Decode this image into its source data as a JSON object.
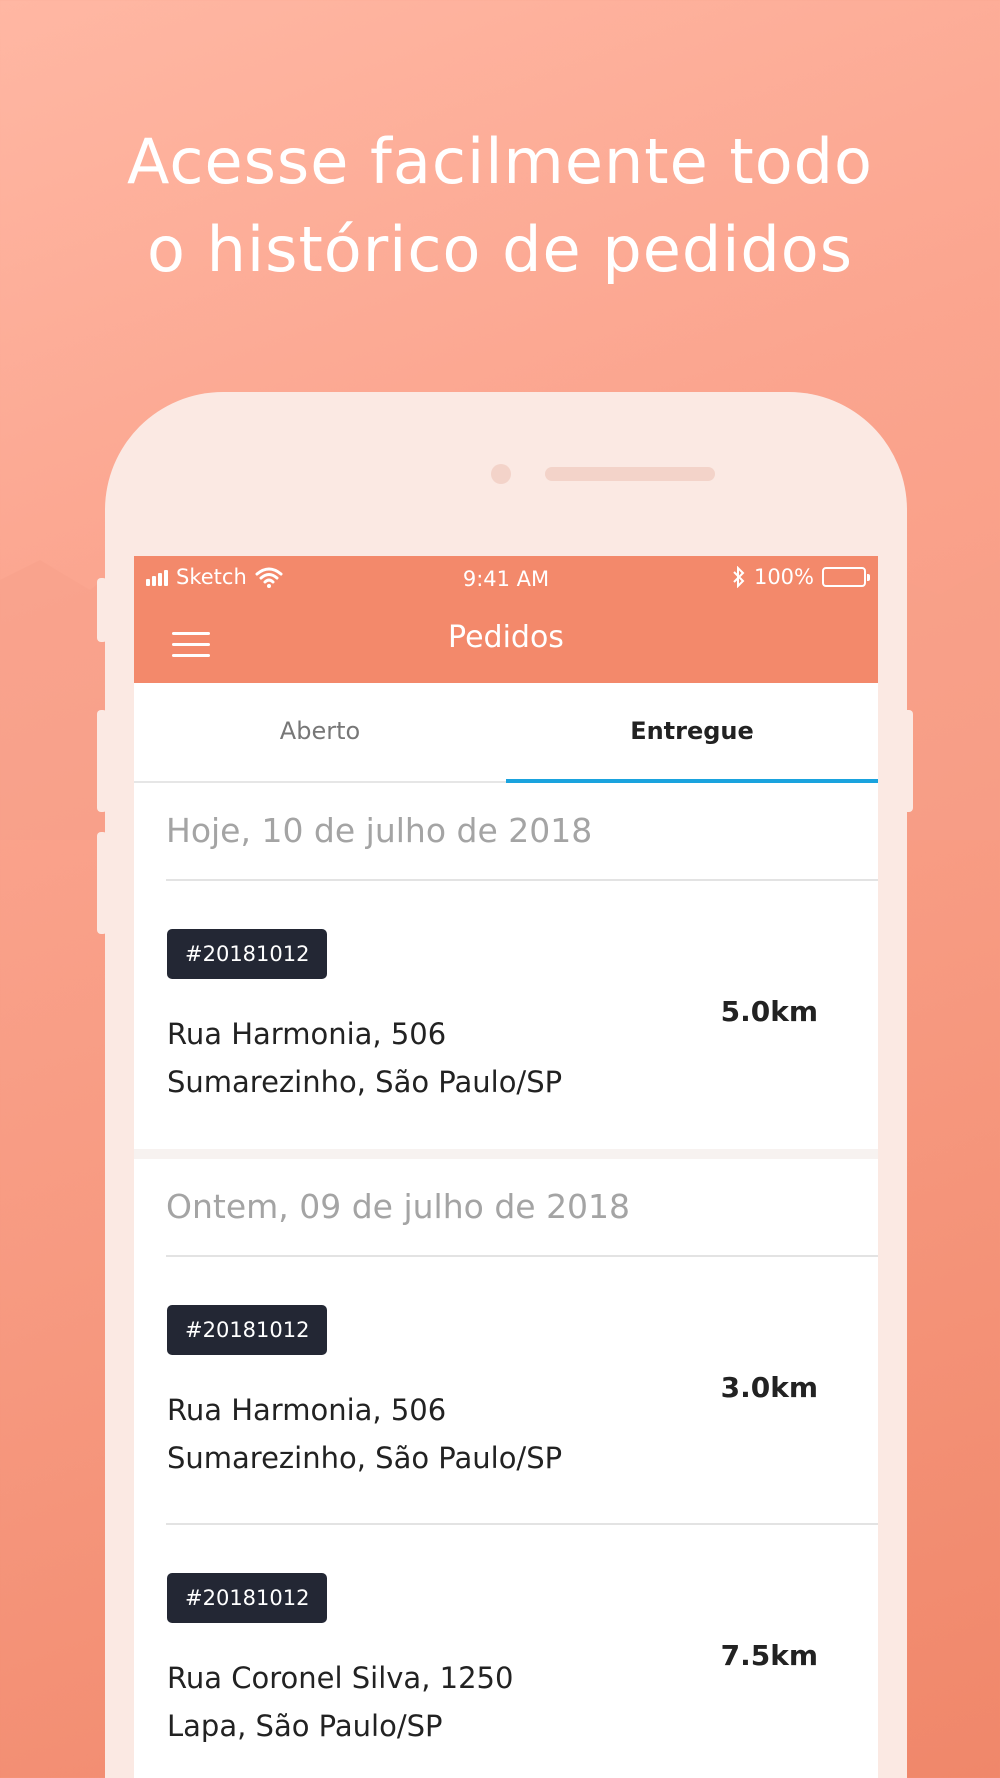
{
  "headline": {
    "line1": "Acesse facilmente todo",
    "line2": "o histórico de pedidos"
  },
  "status_bar": {
    "carrier": "Sketch",
    "time": "9:41 AM",
    "battery": "100%"
  },
  "app_bar": {
    "title": "Pedidos",
    "menu_icon": "hamburger-menu-icon"
  },
  "tabs": [
    {
      "label": "Aberto",
      "active": false
    },
    {
      "label": "Entregue",
      "active": true
    }
  ],
  "sections": [
    {
      "date": "Hoje, 10 de julho de 2018",
      "orders": [
        {
          "id": "#20181012",
          "street": "Rua Harmonia, 506",
          "district": "Sumarezinho, São Paulo/SP",
          "distance": "5.0km"
        }
      ]
    },
    {
      "date": "Ontem, 09 de julho de 2018",
      "orders": [
        {
          "id": "#20181012",
          "street": "Rua Harmonia, 506",
          "district": "Sumarezinho, São Paulo/SP",
          "distance": "3.0km"
        },
        {
          "id": "#20181012",
          "street": "Rua Coronel Silva, 1250",
          "district": "Lapa, São Paulo/SP",
          "distance": "7.5km"
        }
      ]
    }
  ],
  "colors": {
    "app_bar": "#f3896b",
    "tab_indicator": "#1aa3de",
    "badge": "#232734"
  }
}
